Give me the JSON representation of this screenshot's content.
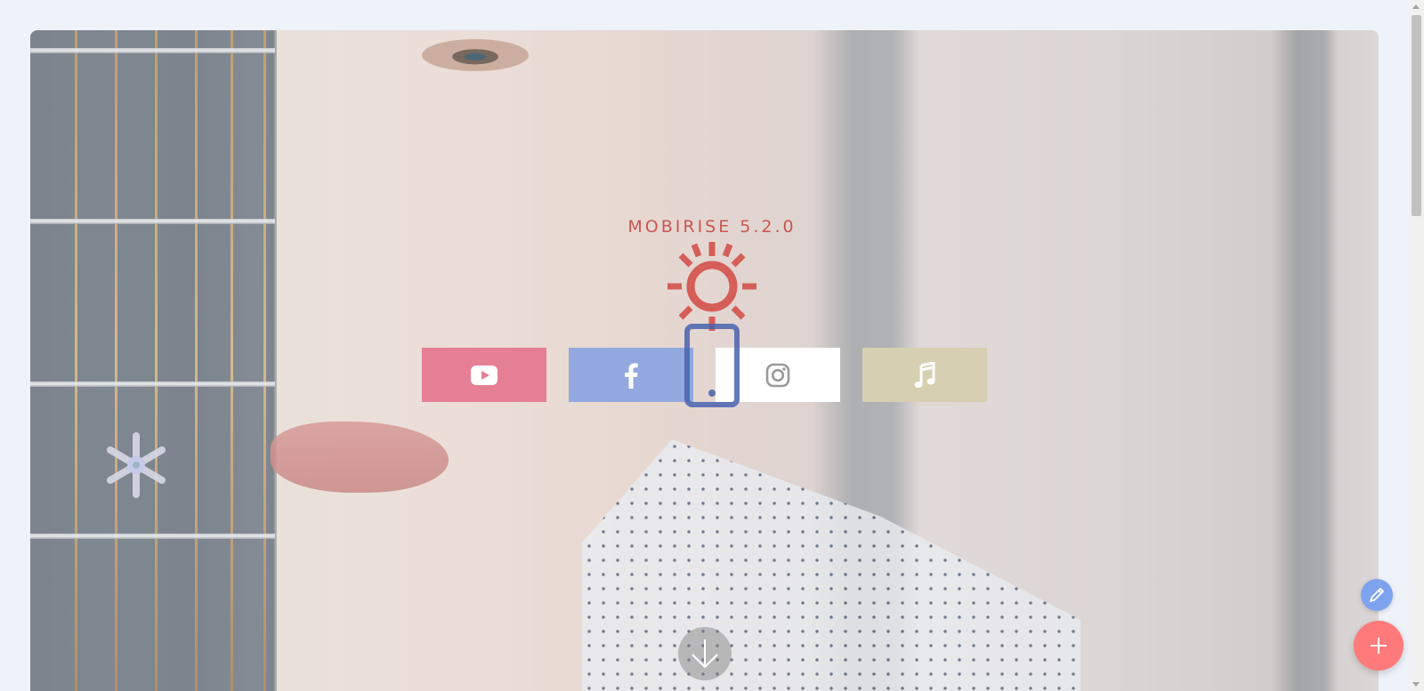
{
  "brand": {
    "text": "MOBIRISE  5.2.0",
    "icon": "sun-icon",
    "color": "#c63f3a"
  },
  "social_buttons": [
    {
      "name": "youtube",
      "icon": "youtube-icon",
      "color": "#e57f96"
    },
    {
      "name": "facebook",
      "icon": "facebook-icon",
      "color": "#92a8de"
    },
    {
      "name": "instagram",
      "icon": "instagram-icon",
      "color": "#ffffff"
    },
    {
      "name": "music",
      "icon": "music-note-icon",
      "color": "#d7cfb1"
    }
  ],
  "overlay_icon": "phone-icon",
  "scroll_down": {
    "icon": "arrow-down-icon"
  },
  "editor": {
    "edit_icon": "pencil-icon",
    "edit_color": "#7ea3ee",
    "add_icon": "plus-icon",
    "add_color": "#ff7a7a"
  }
}
